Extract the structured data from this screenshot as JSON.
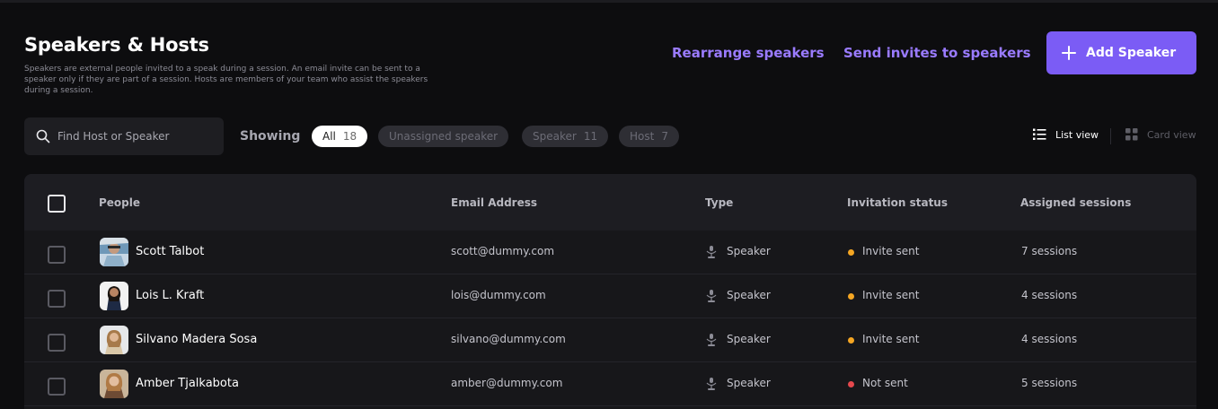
{
  "header": {
    "title": "Speakers & Hosts",
    "description": "Speakers are external people invited to a speak during a session. An email invite can be sent to a speaker only if they are part of a session. Hosts are members of your team who assist the speakers during a session.",
    "rearrange_label": "Rearrange speakers",
    "invites_label": "Send invites to speakers",
    "add_label": "Add Speaker"
  },
  "filters": {
    "search_placeholder": "Find Host or Speaker",
    "showing_label": "Showing",
    "chips": [
      {
        "label": "All",
        "count": "18",
        "active": true
      },
      {
        "label": "Unassigned speaker",
        "count": "",
        "active": false
      },
      {
        "label": "Speaker",
        "count": "11",
        "active": false
      },
      {
        "label": "Host",
        "count": "7",
        "active": false
      }
    ],
    "list_view_label": "List view",
    "card_view_label": "Card view"
  },
  "table": {
    "columns": [
      "People",
      "Email Address",
      "Type",
      "Invitation status",
      "Assigned sessions"
    ],
    "rows": [
      {
        "name": "Scott Talbot",
        "email": "scott@dummy.com",
        "type": "Speaker",
        "status": "Invite sent",
        "sessions": "7 sessions"
      },
      {
        "name": "Lois L. Kraft",
        "email": "lois@dummy.com",
        "type": "Speaker",
        "status": "Invite sent",
        "sessions": "4 sessions"
      },
      {
        "name": "Silvano Madera Sosa",
        "email": "silvano@dummy.com",
        "type": "Speaker",
        "status": "Invite sent",
        "sessions": "4 sessions"
      },
      {
        "name": "Amber Tjalkabota",
        "email": "amber@dummy.com",
        "type": "Speaker",
        "status": "Not sent",
        "sessions": "5 sessions"
      }
    ]
  },
  "colors": {
    "accent": "#7b5cf5",
    "link": "#9a7bff",
    "status_invite_sent": "#f5a623",
    "status_not_sent": "#e5484d"
  },
  "icons": {
    "search": "search-icon",
    "add": "plus-icon",
    "list_view": "list-view-icon",
    "card_view": "grid-view-icon",
    "speaker_type": "microphone-icon"
  }
}
